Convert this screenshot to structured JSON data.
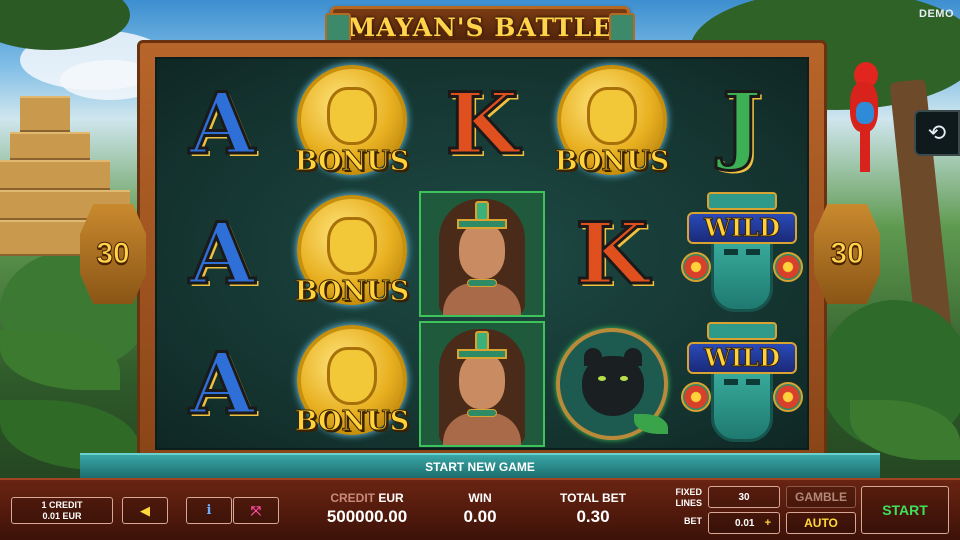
{
  "game": {
    "title": "MAYAN'S BATTLE",
    "mode_badge": "DEMO",
    "lines_count": "30"
  },
  "reels": [
    [
      "A",
      "A",
      "A"
    ],
    [
      "BONUS",
      "BONUS",
      "BONUS"
    ],
    [
      "K",
      "woman",
      "woman"
    ],
    [
      "BONUS",
      "K",
      "panther"
    ],
    [
      "J",
      "WILD",
      "WILD"
    ]
  ],
  "symbols": {
    "bonus_label": "BONUS",
    "wild_label": "WILD",
    "letter_a": "A",
    "letter_k": "K",
    "letter_j": "J"
  },
  "message": "START NEW GAME",
  "controls": {
    "credit_denomination_line1": "1 CREDIT",
    "credit_denomination_line2": "0.01 EUR",
    "sound_icon": "speaker-icon",
    "info_icon": "info-icon",
    "fullscreen_icon": "fullscreen-icon",
    "credit_label_prefix": "CREDIT",
    "credit_label_currency": "EUR",
    "credit_value": "500000.00",
    "win_label": "WIN",
    "win_value": "0.00",
    "total_bet_label": "TOTAL BET",
    "total_bet_value": "0.30",
    "fixed_lines_label_1": "FIXED",
    "fixed_lines_label_2": "LINES",
    "fixed_lines_value": "30",
    "bet_label": "BET",
    "bet_value": "0.01",
    "bet_plus": "+",
    "gamble_label": "GAMBLE",
    "auto_label": "AUTO",
    "start_label": "START",
    "replay_icon": "history-icon"
  },
  "colors": {
    "start_green": "#3ee05a",
    "auto_yellow": "#ffd93a",
    "panel_brown": "#6a2412",
    "reel_bg": "#1e4a45",
    "highlight_green": "#3ec35a"
  }
}
